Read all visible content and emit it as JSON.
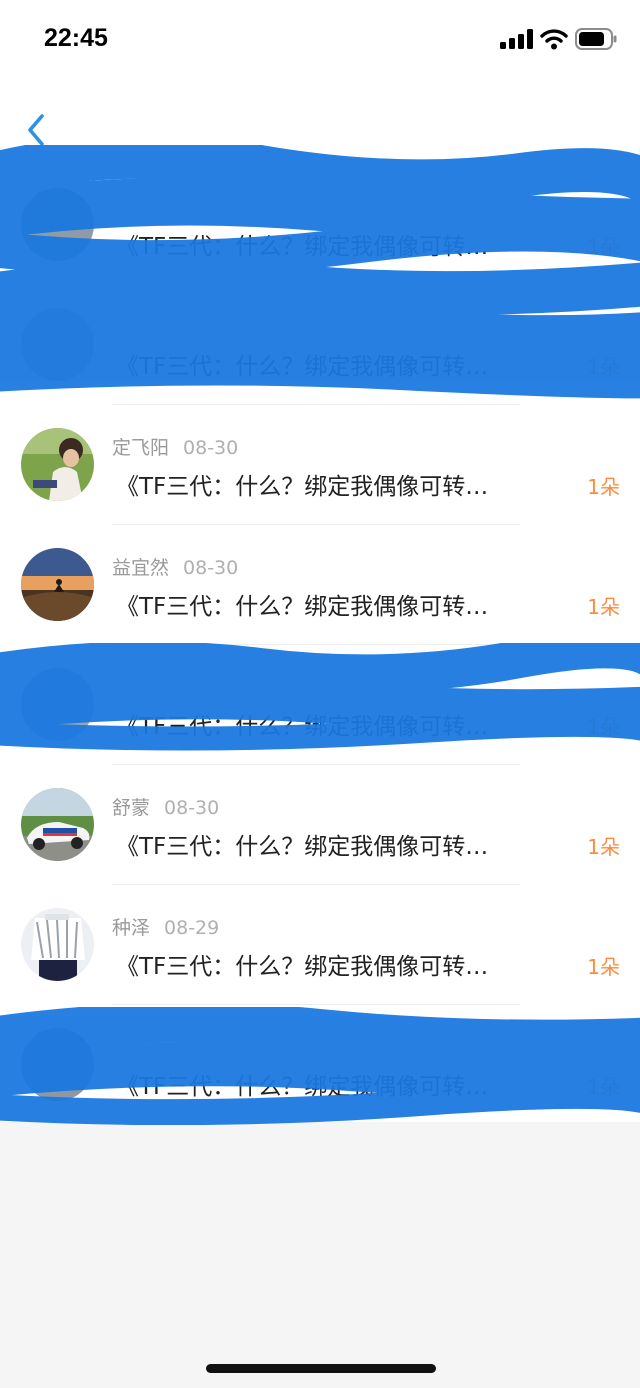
{
  "status_bar": {
    "time": "22:45"
  },
  "header": {
    "back_icon": "chevron-left-icon"
  },
  "colors": {
    "accent": "#2a93e6",
    "scribble": "#1a78e0",
    "count": "#ff8a3d"
  },
  "messages": [
    {
      "name": "",
      "date": "",
      "text": "《TF三代：什么？绑定我偶像可转…",
      "count": "1朵",
      "redacted": true
    },
    {
      "name": "",
      "date": "",
      "text": "《TF三代：什么？绑定我偶像可转…",
      "count": "1朵",
      "redacted": true
    },
    {
      "name": "定飞阳",
      "date": "08-30",
      "text": "《TF三代：什么？绑定我偶像可转…",
      "count": "1朵",
      "redacted": false
    },
    {
      "name": "益宜然",
      "date": "08-30",
      "text": "《TF三代：什么？绑定我偶像可转…",
      "count": "1朵",
      "redacted": false
    },
    {
      "name": "",
      "date": "",
      "text": "《TF三代：什么？绑定我偶像可转…",
      "count": "1朵",
      "redacted": true
    },
    {
      "name": "舒蒙",
      "date": "08-30",
      "text": "《TF三代：什么？绑定我偶像可转…",
      "count": "1朵",
      "redacted": false
    },
    {
      "name": "种泽",
      "date": "08-29",
      "text": "《TF三代：什么？绑定我偶像可转…",
      "count": "1朵",
      "redacted": false
    },
    {
      "name": "",
      "date": "",
      "text": "《TF三代：什么？绑定我偶像可转…",
      "count": "1朵",
      "redacted": true
    }
  ]
}
